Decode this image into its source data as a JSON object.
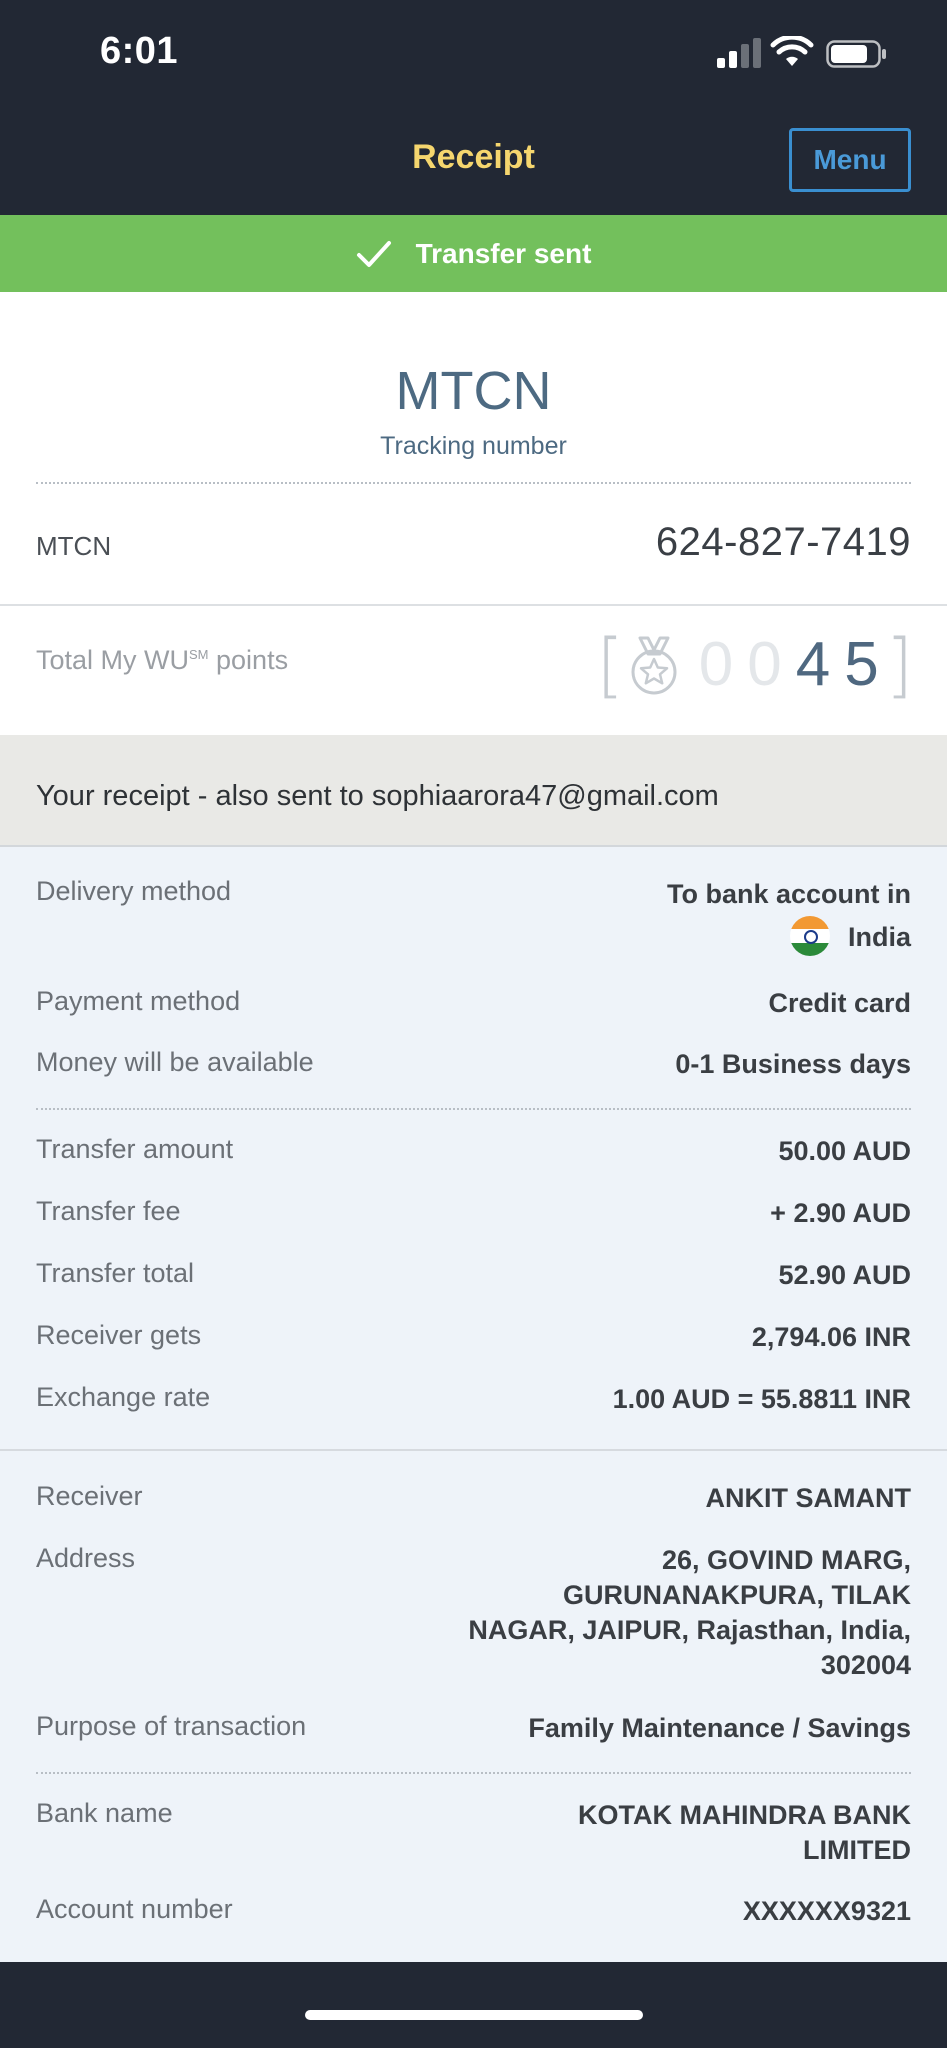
{
  "status_bar": {
    "time": "6:01"
  },
  "header": {
    "title": "Receipt",
    "menu_label": "Menu"
  },
  "banner": {
    "text": "Transfer sent"
  },
  "mtcn": {
    "title": "MTCN",
    "subtitle": "Tracking number",
    "label": "MTCN",
    "value": "624-827-7419"
  },
  "points": {
    "label_main": "Total My WU",
    "label_sup": "SM",
    "label_tail": " points",
    "digits": [
      "0",
      "0",
      "4",
      "5"
    ]
  },
  "receipt_notice": "Your receipt - also sent to sophiaarora47@gmail.com",
  "details": {
    "delivery_method": {
      "label": "Delivery method",
      "value_line1": "To bank account in",
      "value_line2": "India"
    },
    "payment_method": {
      "label": "Payment method",
      "value": "Credit card"
    },
    "availability": {
      "label": "Money will be available",
      "value": "0-1 Business days"
    },
    "transfer_amount": {
      "label": "Transfer amount",
      "value": "50.00 AUD"
    },
    "transfer_fee": {
      "label": "Transfer fee",
      "value": "+ 2.90 AUD"
    },
    "transfer_total": {
      "label": "Transfer total",
      "value": "52.90 AUD"
    },
    "receiver_gets": {
      "label": "Receiver gets",
      "value": "2,794.06 INR"
    },
    "exchange_rate": {
      "label": "Exchange rate",
      "value": "1.00 AUD = 55.8811 INR"
    },
    "receiver": {
      "label": "Receiver",
      "value": "ANKIT SAMANT"
    },
    "address": {
      "label": "Address",
      "lines": [
        "26, GOVIND MARG,",
        "GURUNANAKPURA, TILAK",
        "NAGAR, JAIPUR, Rajasthan, India,",
        "302004"
      ]
    },
    "purpose": {
      "label": "Purpose of transaction",
      "value": "Family Maintenance / Savings"
    },
    "bank_name": {
      "label": "Bank name",
      "lines": [
        "KOTAK MAHINDRA BANK",
        "LIMITED"
      ]
    },
    "account_number": {
      "label": "Account number",
      "value": "XXXXXX9321"
    }
  },
  "colors": {
    "header_bg": "#222834",
    "title": "#f5d66e",
    "menu_accent": "#3a8fd0",
    "success_green": "#73c05c",
    "mtcn_blue": "#4d6a82"
  }
}
